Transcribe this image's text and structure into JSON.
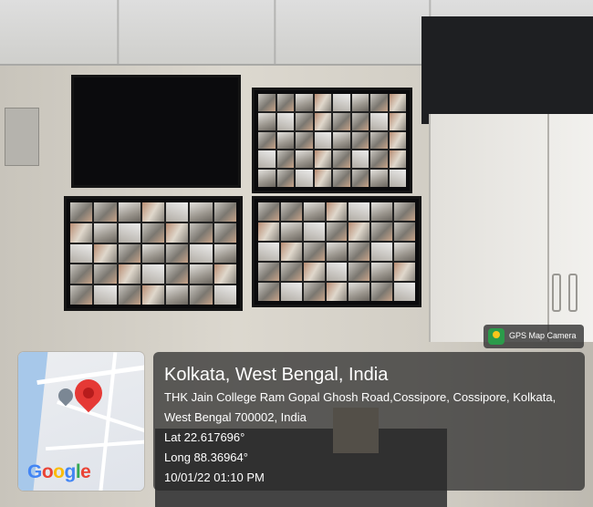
{
  "overlay": {
    "badge_label": "GPS Map Camera",
    "location_title": "Kolkata, West Bengal, India",
    "address_line1": "THK Jain College Ram Gopal Ghosh Road,Cossipore, Cossipore, Kolkata,",
    "address_line2": "West Bengal 700002, India",
    "latitude": "Lat 22.617696°",
    "longitude": "Long 88.36964°",
    "timestamp": "10/01/22 01:10 PM"
  },
  "map": {
    "brand": "Google",
    "pin_color": "#e53935"
  }
}
